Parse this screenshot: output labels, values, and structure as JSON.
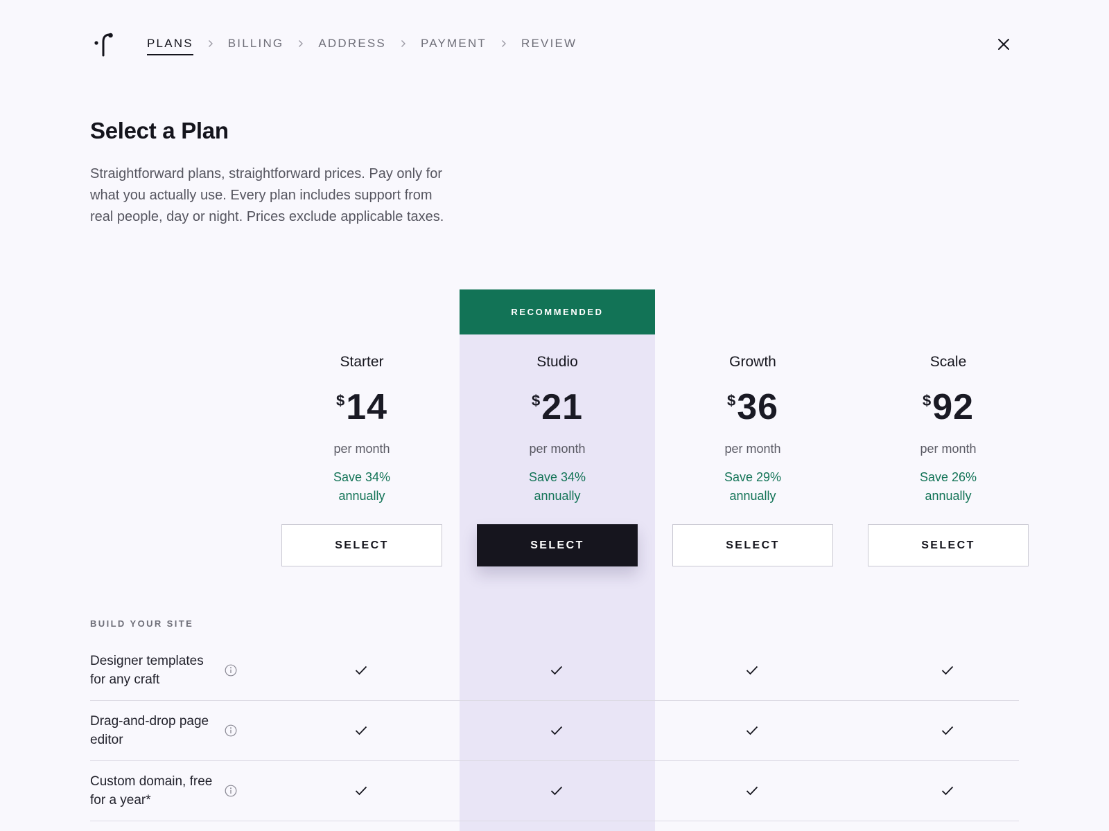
{
  "nav": {
    "steps": [
      {
        "label": "PLANS",
        "active": true
      },
      {
        "label": "BILLING",
        "active": false
      },
      {
        "label": "ADDRESS",
        "active": false
      },
      {
        "label": "PAYMENT",
        "active": false
      },
      {
        "label": "REVIEW",
        "active": false
      }
    ],
    "close_icon": "close-icon",
    "logo_icon": "brand-logo"
  },
  "header": {
    "title": "Select a Plan",
    "intro": "Straightforward plans, straightforward prices. Pay only for what you actually use. Every plan includes support from real people, day or night. Prices exclude applicable taxes."
  },
  "recommended_label": "RECOMMENDED",
  "plans": [
    {
      "name": "Starter",
      "currency": "$",
      "price": "14",
      "period": "per month",
      "save": "Save 34% annually",
      "button": "SELECT",
      "recommended": false
    },
    {
      "name": "Studio",
      "currency": "$",
      "price": "21",
      "period": "per month",
      "save": "Save 34% annually",
      "button": "SELECT",
      "recommended": true
    },
    {
      "name": "Growth",
      "currency": "$",
      "price": "36",
      "period": "per month",
      "save": "Save 29% annually",
      "button": "SELECT",
      "recommended": false
    },
    {
      "name": "Scale",
      "currency": "$",
      "price": "92",
      "period": "per month",
      "save": "Save 26% annually",
      "button": "SELECT",
      "recommended": false
    }
  ],
  "features": {
    "section_label": "BUILD YOUR SITE",
    "items": [
      {
        "label": "Designer templates for any craft",
        "included": [
          true,
          true,
          true,
          true
        ]
      },
      {
        "label": "Drag-and-drop page editor",
        "included": [
          true,
          true,
          true,
          true
        ]
      },
      {
        "label": "Custom domain, free for a year*",
        "included": [
          true,
          true,
          true,
          true
        ]
      }
    ]
  },
  "colors": {
    "accent_green": "#127356",
    "recommended_bg": "#e9e5f6",
    "primary_button": "#16151e",
    "page_bg": "#f9f8fd"
  }
}
